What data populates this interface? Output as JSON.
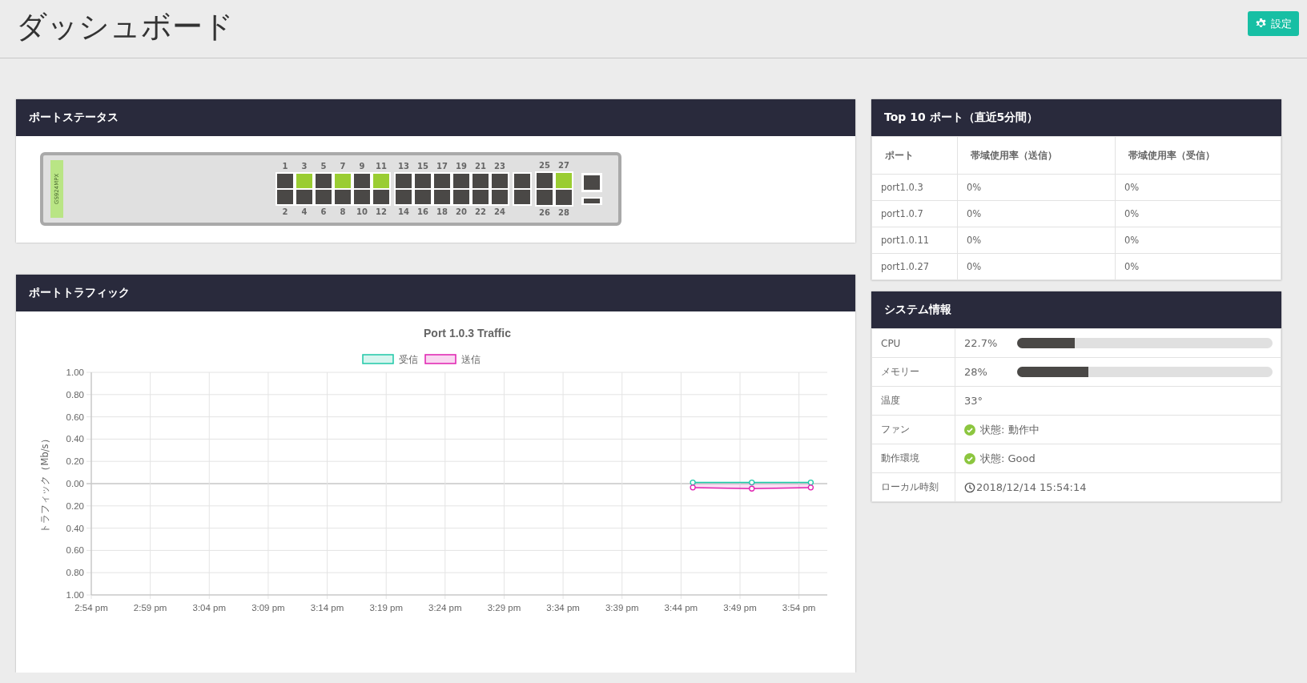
{
  "page_title": "ダッシュボード",
  "settings_button": "設定",
  "port_status": {
    "title": "ポートステータス",
    "model": "GS924MPX",
    "groups": [
      {
        "kind": "rj45",
        "ports": [
          {
            "label": "1",
            "up": false
          },
          {
            "label": "2",
            "up": false
          },
          {
            "label": "3",
            "up": true
          },
          {
            "label": "4",
            "up": false
          },
          {
            "label": "5",
            "up": false
          },
          {
            "label": "6",
            "up": false
          },
          {
            "label": "7",
            "up": true
          },
          {
            "label": "8",
            "up": false
          },
          {
            "label": "9",
            "up": false
          },
          {
            "label": "10",
            "up": false
          },
          {
            "label": "11",
            "up": true
          },
          {
            "label": "12",
            "up": false
          }
        ]
      },
      {
        "kind": "rj45",
        "ports": [
          {
            "label": "13",
            "up": false
          },
          {
            "label": "14",
            "up": false
          },
          {
            "label": "15",
            "up": false
          },
          {
            "label": "16",
            "up": false
          },
          {
            "label": "17",
            "up": false
          },
          {
            "label": "18",
            "up": false
          },
          {
            "label": "19",
            "up": false
          },
          {
            "label": "20",
            "up": false
          },
          {
            "label": "21",
            "up": false
          },
          {
            "label": "22",
            "up": false
          },
          {
            "label": "23",
            "up": false
          },
          {
            "label": "24",
            "up": false
          }
        ]
      },
      {
        "kind": "sfp",
        "ports": [
          {
            "label": "25",
            "up": false
          },
          {
            "label": "26",
            "up": false
          },
          {
            "label": "27",
            "up": true
          },
          {
            "label": "28",
            "up": false
          }
        ]
      }
    ]
  },
  "port_traffic": {
    "title": "ポートトラフィック",
    "chart_data": {
      "type": "area",
      "grid": true,
      "legend": true,
      "title": "Port 1.0.3 Traffic",
      "ylabel": "トラフィック（Mb/s）",
      "ylim": [
        -1,
        1
      ],
      "categories": [
        "2:54 pm",
        null,
        null,
        null,
        null,
        "2:59 pm",
        null,
        null,
        null,
        null,
        "3:04 pm",
        null,
        null,
        null,
        null,
        "3:09 pm",
        null,
        null,
        null,
        null,
        "3:14 pm",
        null,
        null,
        null,
        null,
        "3:19 pm",
        null,
        null,
        null,
        null,
        "3:24 pm",
        null,
        null,
        null,
        null,
        "3:29 pm",
        null,
        null,
        null,
        null,
        "3:34 pm",
        null,
        null,
        null,
        null,
        "3:39 pm",
        null,
        null,
        null,
        null,
        "3:44 pm",
        null,
        null,
        null,
        null,
        "3:49 pm",
        null,
        null,
        null,
        null,
        "3:54 pm",
        null,
        null
      ],
      "yticks": [
        {
          "value": 1,
          "label": "1.00"
        },
        {
          "value": 0.8,
          "label": "0.80"
        },
        {
          "value": 0.6,
          "label": "0.60"
        },
        {
          "value": 0.4,
          "label": "0.40"
        },
        {
          "value": 0.2,
          "label": "0.20"
        },
        {
          "value": 0,
          "label": "0.00"
        },
        {
          "value": -0.2,
          "label": "0.20"
        },
        {
          "value": -0.4,
          "label": "0.40"
        },
        {
          "value": -0.6,
          "label": "0.60"
        },
        {
          "value": -0.8,
          "label": "0.80"
        },
        {
          "value": -1,
          "label": "1.00"
        }
      ],
      "series": [
        {
          "name": "受信",
          "color": "#1fc8a8",
          "marker": "circle",
          "values": [
            null,
            null,
            null,
            null,
            null,
            null,
            null,
            null,
            null,
            null,
            null,
            null,
            null,
            null,
            null,
            null,
            null,
            null,
            null,
            null,
            null,
            null,
            null,
            null,
            null,
            null,
            null,
            null,
            null,
            null,
            null,
            null,
            null,
            null,
            null,
            null,
            null,
            null,
            null,
            null,
            null,
            null,
            null,
            null,
            null,
            null,
            null,
            null,
            null,
            null,
            null,
            0.01,
            null,
            null,
            null,
            null,
            0.01,
            null,
            null,
            null,
            null,
            0.01,
            null
          ]
        },
        {
          "name": "送信",
          "color": "#e020b0",
          "marker": "circle",
          "values": [
            null,
            null,
            null,
            null,
            null,
            null,
            null,
            null,
            null,
            null,
            null,
            null,
            null,
            null,
            null,
            null,
            null,
            null,
            null,
            null,
            null,
            null,
            null,
            null,
            null,
            null,
            null,
            null,
            null,
            null,
            null,
            null,
            null,
            null,
            null,
            null,
            null,
            null,
            null,
            null,
            null,
            null,
            null,
            null,
            null,
            null,
            null,
            null,
            null,
            null,
            null,
            -0.035,
            null,
            null,
            null,
            null,
            -0.045,
            null,
            null,
            null,
            null,
            -0.035,
            null
          ]
        }
      ]
    }
  },
  "top_ports": {
    "title": "Top 10 ポート（直近5分間）",
    "columns": [
      "ポート",
      "帯域使用率（送信）",
      "帯域使用率（受信）"
    ],
    "rows": [
      [
        "port1.0.3",
        "0%",
        "0%"
      ],
      [
        "port1.0.7",
        "0%",
        "0%"
      ],
      [
        "port1.0.11",
        "0%",
        "0%"
      ],
      [
        "port1.0.27",
        "0%",
        "0%"
      ]
    ]
  },
  "system_info": {
    "title": "システム情報",
    "rows": [
      {
        "kind": "meter",
        "label": "CPU",
        "value": "22.7%",
        "level": 0.227
      },
      {
        "kind": "meter",
        "label": "メモリー",
        "value": "28%",
        "level": 0.28
      },
      {
        "kind": "text",
        "label": "温度",
        "value": "33°"
      },
      {
        "kind": "status",
        "label": "ファン",
        "value": "状態: 動作中",
        "ok": true
      },
      {
        "kind": "status",
        "label": "動作環境",
        "value": "状態: Good",
        "ok": true
      },
      {
        "kind": "time",
        "label": "ローカル時刻",
        "value": "2018/12/14 15:54:14"
      }
    ]
  }
}
